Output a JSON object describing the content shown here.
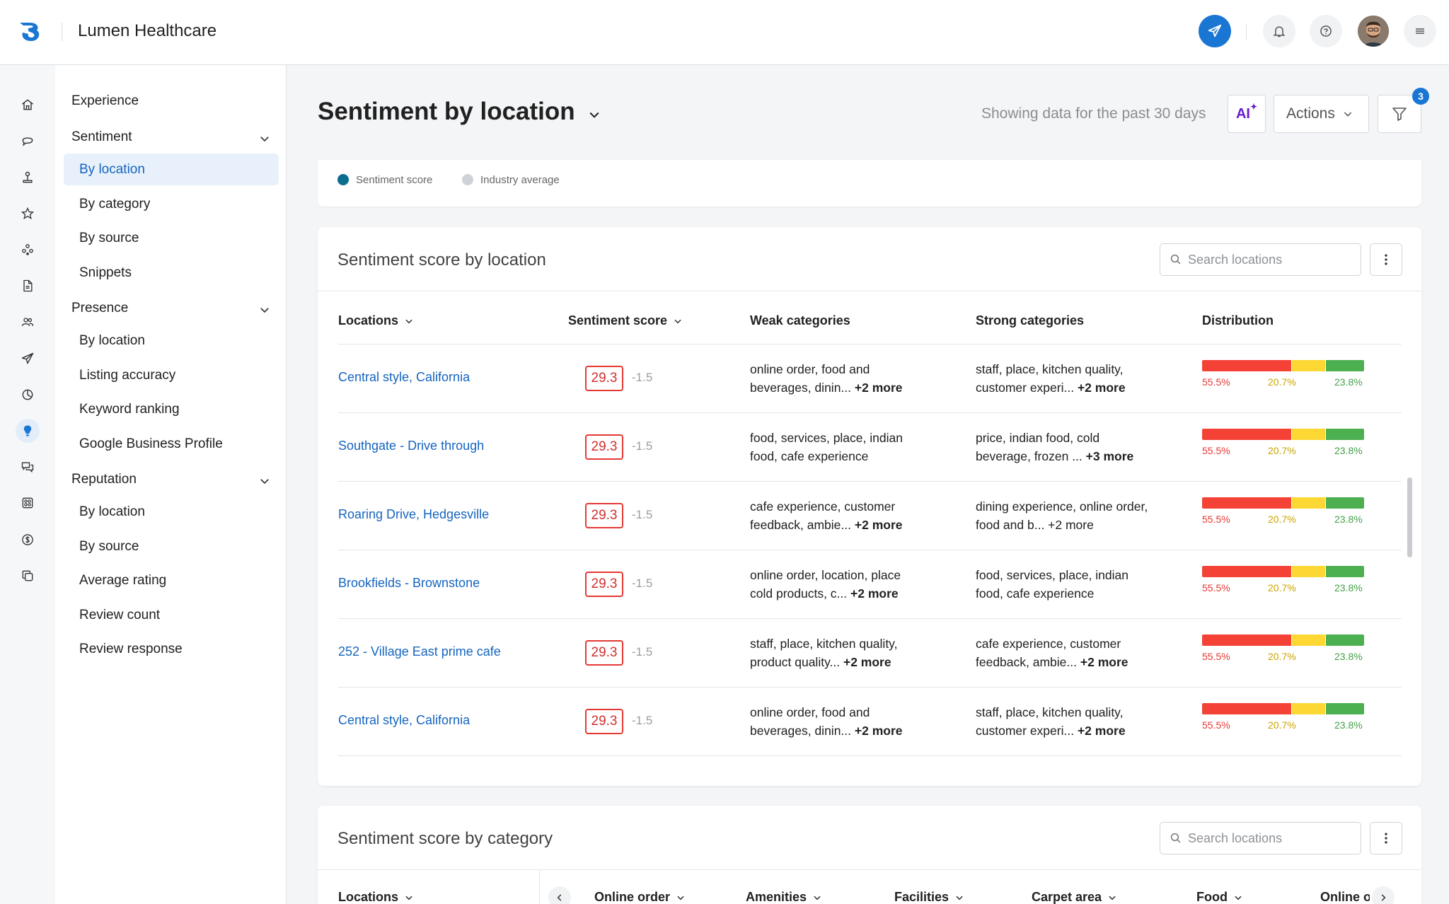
{
  "app": {
    "name": "Lumen Healthcare",
    "colors": {
      "primary": "#1976d2",
      "link": "#1565c0",
      "negative": "#f44336",
      "neutral": "#fdd835",
      "positive": "#4caf50"
    }
  },
  "header": {
    "icons": [
      "send-icon",
      "bell-icon",
      "help-icon",
      "avatar",
      "menu-icon"
    ]
  },
  "rail": {
    "icons": [
      "home-icon",
      "chat-bubble-icon",
      "joystick-icon",
      "star-icon",
      "network-icon",
      "document-icon",
      "people-icon",
      "send-icon",
      "pie-chart-icon",
      "lightbulb-icon",
      "messages-icon",
      "grid-icon",
      "dollar-icon",
      "copy-icon"
    ],
    "active": "lightbulb-icon"
  },
  "nav": {
    "experience": "Experience",
    "sentiment": {
      "label": "Sentiment",
      "items": [
        "By location",
        "By category",
        "By source",
        "Snippets"
      ],
      "active": "By location"
    },
    "presence": {
      "label": "Presence",
      "items": [
        "By location",
        "Listing accuracy",
        "Keyword ranking",
        "Google Business Profile"
      ]
    },
    "reputation": {
      "label": "Reputation",
      "items": [
        "By location",
        "By source",
        "Average rating",
        "Review count",
        "Review response"
      ]
    }
  },
  "page": {
    "title": "Sentiment by location",
    "showing": "Showing data for the past 30 days",
    "ai_label": "AI",
    "actions_label": "Actions",
    "filter_count": "3"
  },
  "legend": {
    "items": [
      {
        "label": "Sentiment score",
        "color": "#0b6e8f"
      },
      {
        "label": "Industry average",
        "color": "#cfd2d6"
      }
    ]
  },
  "location_card": {
    "title": "Sentiment score by location",
    "search_placeholder": "Search locations",
    "columns": {
      "locations": "Locations",
      "score": "Sentiment score",
      "weak": "Weak categories",
      "strong": "Strong categories",
      "distribution": "Distribution"
    },
    "rows": [
      {
        "location": "Central style, California",
        "score": "29.3",
        "delta": "-1.5",
        "weak_text": "online order, food and beverages, dinin...",
        "weak_more": "+2 more",
        "strong_text": "staff, place, kitchen quality, customer experi...",
        "strong_more": "+2 more",
        "dist": [
          55.5,
          20.7,
          23.8
        ],
        "dist_labels": [
          "55.5%",
          "20.7%",
          "23.8%"
        ]
      },
      {
        "location": "Southgate - Drive through",
        "score": "29.3",
        "delta": "-1.5",
        "weak_text": "food, services, place, indian food, cafe experience",
        "weak_more": "",
        "strong_text": "price, indian food, cold beverage, frozen ...",
        "strong_more": "+3 more",
        "dist": [
          55.5,
          20.7,
          23.8
        ],
        "dist_labels": [
          "55.5%",
          "20.7%",
          "23.8%"
        ]
      },
      {
        "location": "Roaring Drive, Hedgesville",
        "score": "29.3",
        "delta": "-1.5",
        "weak_text": "cafe experience, customer feedback, ambie...",
        "weak_more": "+2 more",
        "strong_text": "dining experience, online order, food and b... +2 more",
        "strong_more": "",
        "dist": [
          55.5,
          20.7,
          23.8
        ],
        "dist_labels": [
          "55.5%",
          "20.7%",
          "23.8%"
        ]
      },
      {
        "location": "Brookfields - Brownstone",
        "score": "29.3",
        "delta": "-1.5",
        "weak_text": "online order, location, place cold products, c...",
        "weak_more": "+2 more",
        "strong_text": "food, services, place, indian food, cafe experience",
        "strong_more": "",
        "dist": [
          55.5,
          20.7,
          23.8
        ],
        "dist_labels": [
          "55.5%",
          "20.7%",
          "23.8%"
        ]
      },
      {
        "location": "252 - Village East prime cafe",
        "score": "29.3",
        "delta": "-1.5",
        "weak_text": "staff, place, kitchen quality, product quality...",
        "weak_more": "+2 more",
        "strong_text": "cafe experience, customer feedback, ambie...",
        "strong_more": "+2 more",
        "dist": [
          55.5,
          20.7,
          23.8
        ],
        "dist_labels": [
          "55.5%",
          "20.7%",
          "23.8%"
        ]
      },
      {
        "location": "Central style, California",
        "score": "29.3",
        "delta": "-1.5",
        "weak_text": "online order, food and beverages, dinin...",
        "weak_more": "+2 more",
        "strong_text": "staff, place, kitchen quality, customer experi...",
        "strong_more": "+2 more",
        "dist": [
          55.5,
          20.7,
          23.8
        ],
        "dist_labels": [
          "55.5%",
          "20.7%",
          "23.8%"
        ]
      }
    ]
  },
  "category_card": {
    "title": "Sentiment score by category",
    "search_placeholder": "Search locations",
    "columns": [
      "Locations",
      "Online order",
      "Amenities",
      "Facilities",
      "Carpet area",
      "Food",
      "Online o"
    ]
  }
}
